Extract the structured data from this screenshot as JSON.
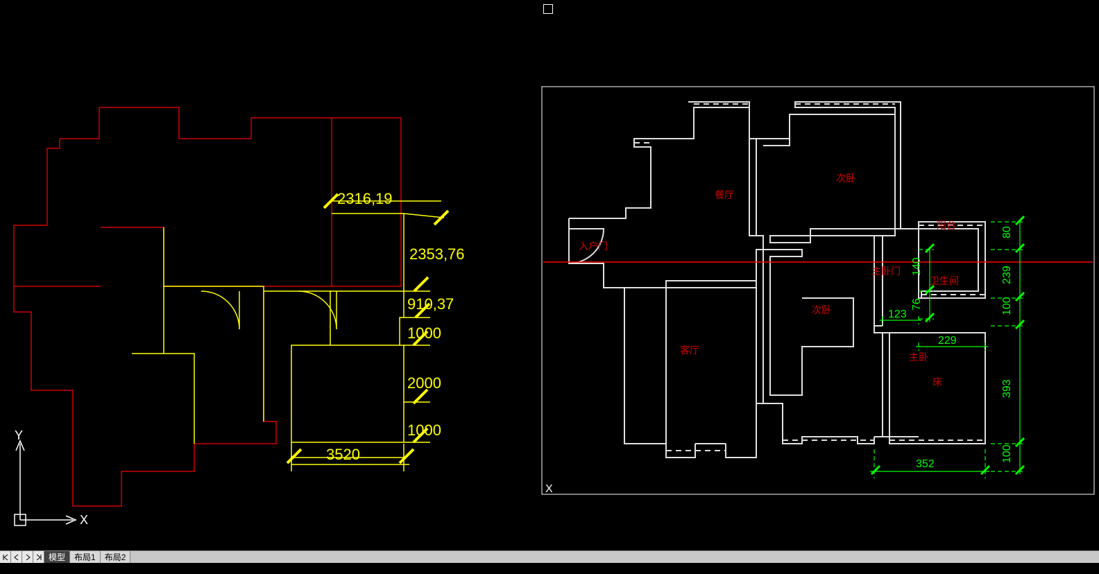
{
  "tabs": {
    "model": "模型",
    "layout1": "布局1",
    "layout2": "布局2"
  },
  "ucs": {
    "x": "X",
    "y": "Y",
    "x2": "X"
  },
  "left_drawing": {
    "dims": {
      "d1": "2316,19",
      "d2": "2353,76",
      "d3": "910,37",
      "d4": "1000",
      "d5": "2000",
      "d6": "1000",
      "d7": "3520"
    }
  },
  "right_drawing": {
    "rooms": {
      "dining": "餐厅",
      "bedroom2a": "次卧",
      "entry": "入户门",
      "master_door": "主卧门",
      "balcony": "阳台",
      "bathroom": "卫生间",
      "living": "客厅",
      "bedroom2b": "次卧",
      "master": "主卧",
      "bed": "床"
    },
    "dims": {
      "d80": "80",
      "d239": "239",
      "d140": "140",
      "d76": "76",
      "d123": "123",
      "d229": "229",
      "d100a": "100",
      "d393": "393",
      "d100b": "100",
      "d352": "352"
    }
  }
}
